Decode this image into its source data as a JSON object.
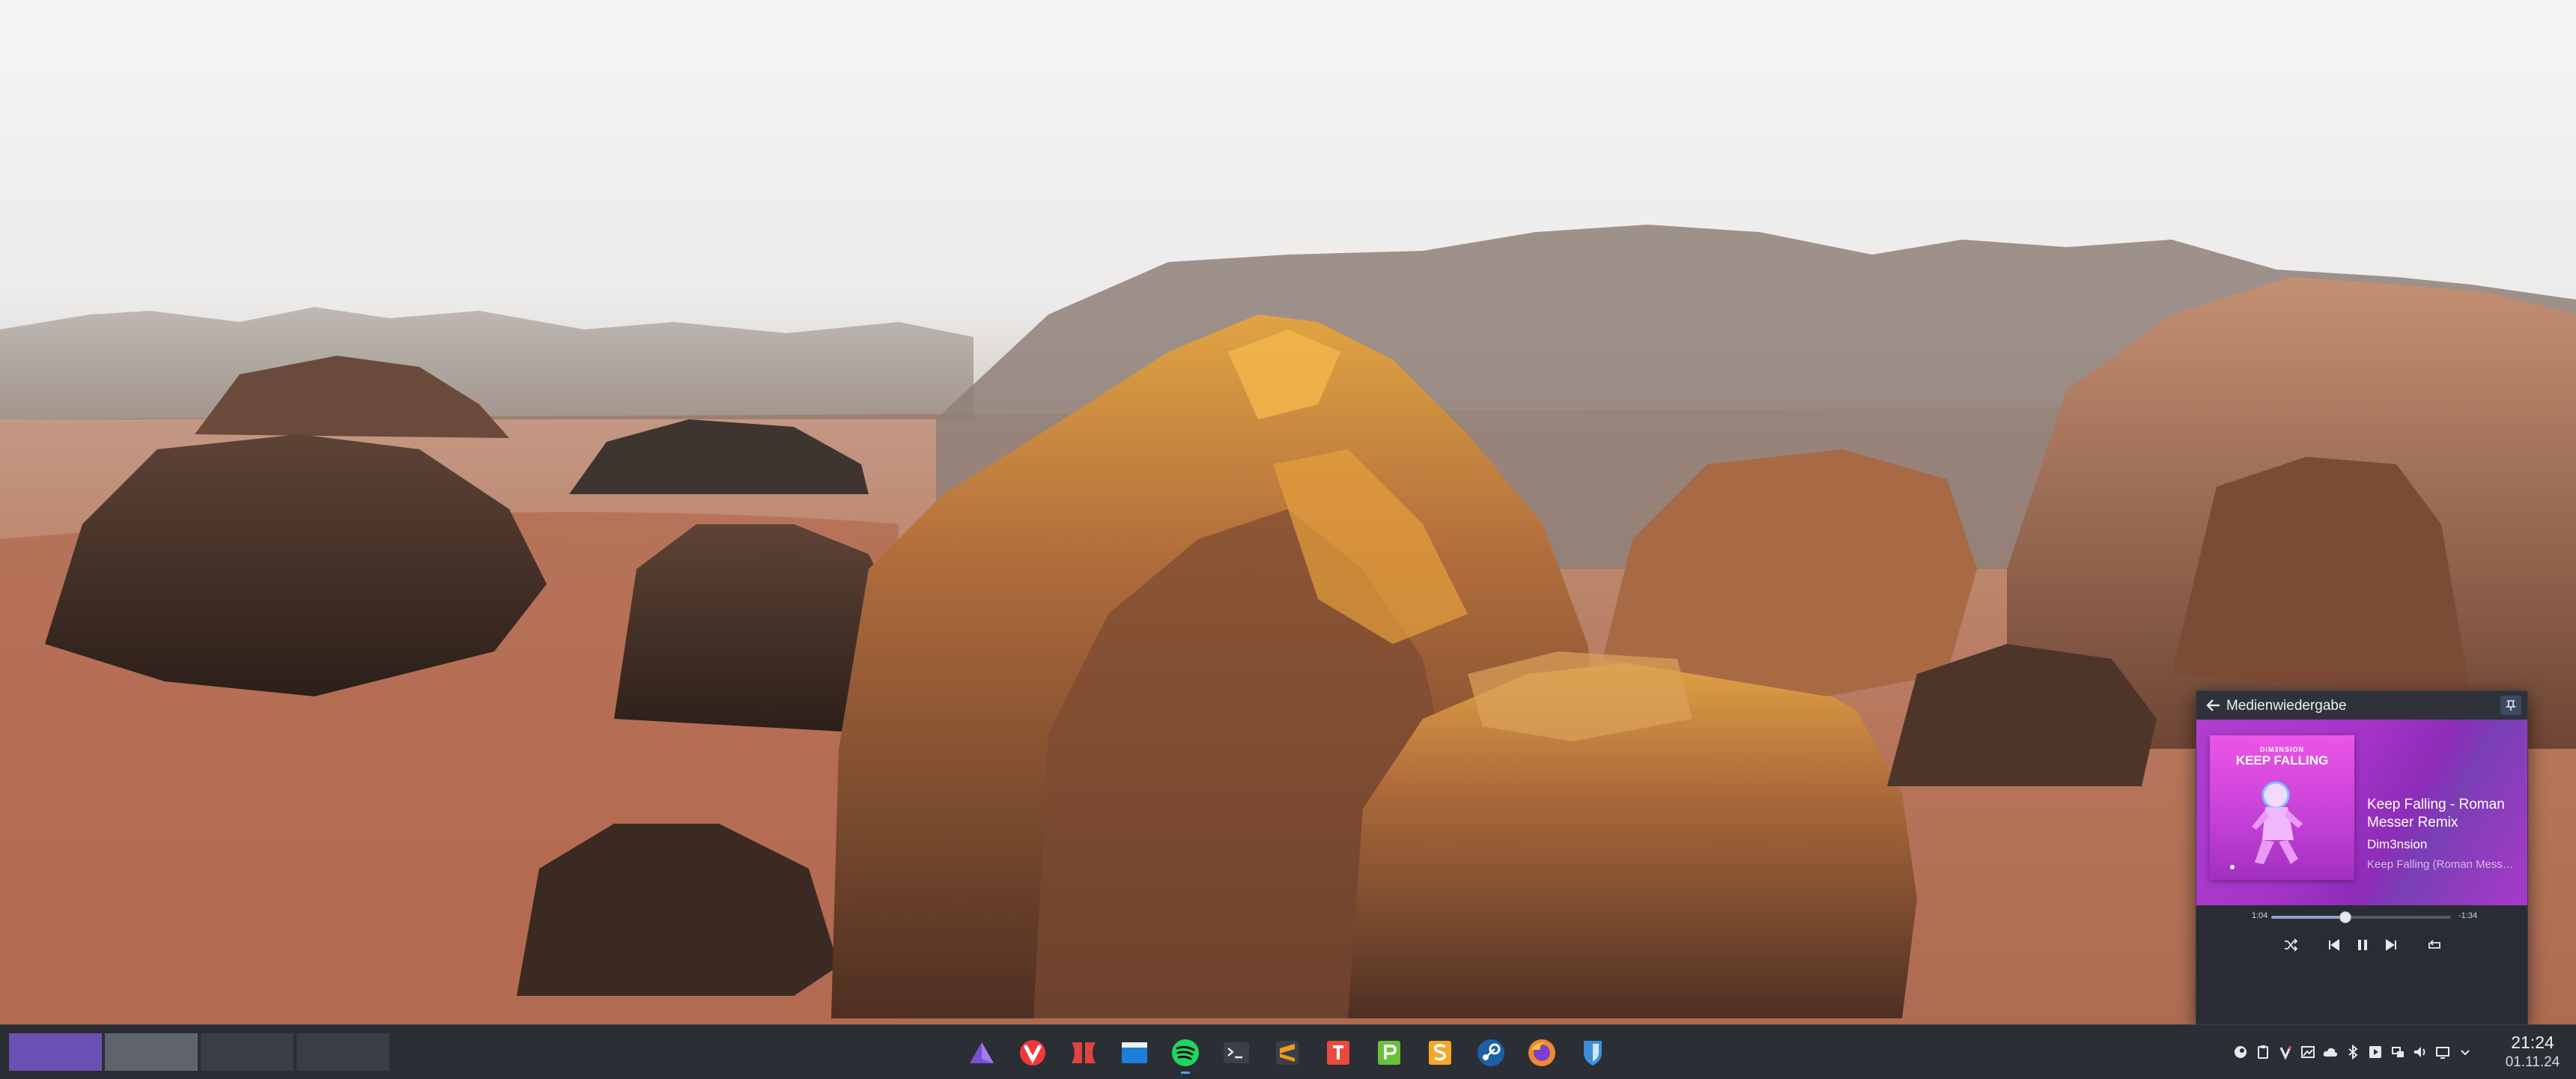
{
  "media_player": {
    "header_title": "Medienwiedergabe",
    "album_art_artist": "DIM3NSION",
    "album_art_title": "KEEP FALLING",
    "track_title": "Keep Falling - Roman Messer Remix",
    "track_artist": "Dim3nsion",
    "track_album": "Keep Falling (Roman Messer Remix)",
    "elapsed": "1:04",
    "remaining": "-1:34",
    "progress_fraction": 0.41,
    "controls": [
      "shuffle-icon",
      "previous-icon",
      "pause-icon",
      "next-icon",
      "repeat-icon"
    ],
    "accent_color": "#a534c8"
  },
  "taskbar": {
    "virtual_desktops": [
      {
        "active": true,
        "color": "#6a4fb5"
      },
      {
        "active": false,
        "color": "#5f636b"
      },
      {
        "active": false,
        "color": "#3a3d45"
      },
      {
        "active": false,
        "color": "#3a3d45"
      }
    ],
    "launchers": [
      {
        "icon": "app-launcher-triangle-icon",
        "color": "#7a4fd6"
      },
      {
        "icon": "vivaldi-icon",
        "color": "#ef3939"
      },
      {
        "icon": "davinci-resolve-icon",
        "color": "#e0443f"
      },
      {
        "icon": "dolphin-file-manager-icon",
        "color": "#1e7fd8"
      },
      {
        "icon": "spotify-icon",
        "color": "#1ed760",
        "running": true
      },
      {
        "icon": "terminal-icon",
        "color": "#3a3f48"
      },
      {
        "icon": "sublime-text-icon",
        "color": "#f09a1a"
      },
      {
        "icon": "libreoffice-writer-icon",
        "color": "#e84a3c"
      },
      {
        "icon": "libreoffice-calc-icon",
        "color": "#6bbf3a"
      },
      {
        "icon": "libreoffice-impress-icon",
        "color": "#f4a72a"
      },
      {
        "icon": "steam-icon",
        "color": "#1b5fa8"
      },
      {
        "icon": "firefox-icon",
        "color": "#f08a2a"
      },
      {
        "icon": "bitwarden-shield-icon",
        "color": "#3b8fd9"
      }
    ],
    "tray_icons": [
      "steam-tray-icon",
      "clipboard-icon",
      "vivaldi-tray-icon",
      "image-icon",
      "cloud-icon",
      "bluetooth-icon",
      "spotify-tray-icon",
      "network-icon",
      "volume-icon",
      "display-icon",
      "expand-tray-icon"
    ],
    "clock_time": "21:24",
    "clock_date": "01.11.24"
  }
}
